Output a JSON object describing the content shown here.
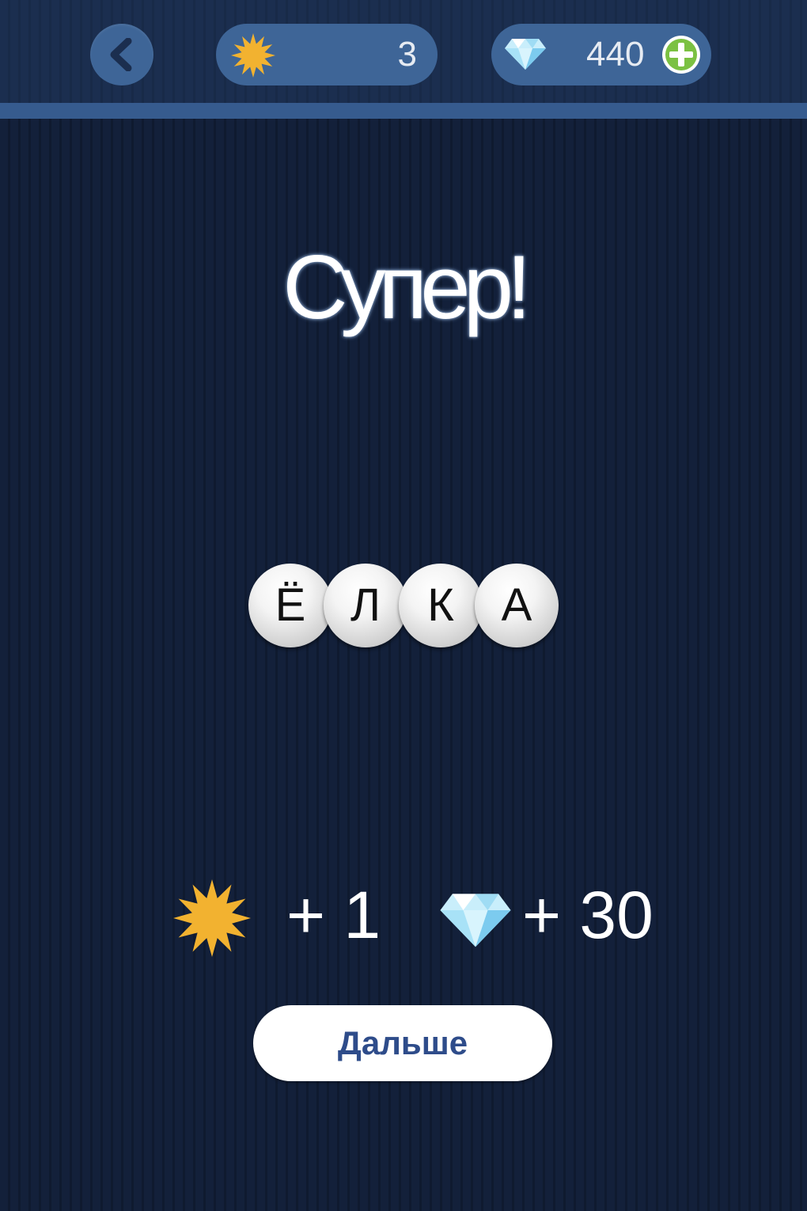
{
  "header": {
    "back_icon": "chevron-left-icon",
    "stars": {
      "icon": "star-burst-icon",
      "count": "3"
    },
    "gems": {
      "icon": "diamond-icon",
      "count": "440",
      "add_icon": "plus-circle-icon"
    }
  },
  "result": {
    "title": "Супер!",
    "answer_letters": [
      "Ё",
      "Л",
      "К",
      "А"
    ]
  },
  "rewards": {
    "stars": "+ 1",
    "gems": "+ 30"
  },
  "next_button": {
    "label": "Дальше"
  },
  "colors": {
    "background": "#13203a",
    "topbar": "#1b2e4f",
    "pill": "#3e6597",
    "star": "#f2b230",
    "add_green": "#7bc142",
    "button_text": "#2e4c8a"
  }
}
